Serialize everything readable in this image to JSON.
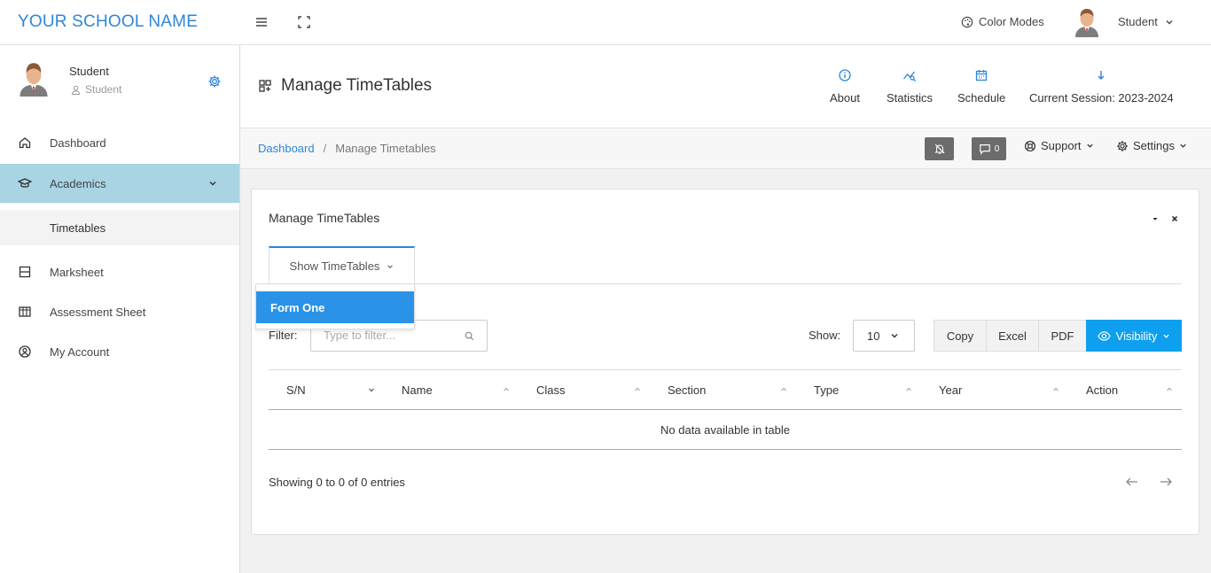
{
  "brand": "YOUR SCHOOL NAME",
  "topbar": {
    "color_modes_label": "Color Modes",
    "user_label": "Student"
  },
  "sidebar": {
    "user_name": "Student",
    "user_role": "Student",
    "items": [
      {
        "label": "Dashboard",
        "icon": "home-icon"
      },
      {
        "label": "Academics",
        "icon": "graduation-cap-icon"
      },
      {
        "label": "Timetables",
        "icon": ""
      },
      {
        "label": "Marksheet",
        "icon": "marksheet-icon"
      },
      {
        "label": "Assessment Sheet",
        "icon": "assessment-icon"
      },
      {
        "label": "My Account",
        "icon": "user-circle-icon"
      }
    ]
  },
  "page_header": {
    "title": "Manage TimeTables",
    "actions": [
      {
        "label": "About",
        "icon": "info-icon"
      },
      {
        "label": "Statistics",
        "icon": "chart-icon"
      },
      {
        "label": "Schedule",
        "icon": "calendar-icon"
      },
      {
        "label": "Current Session: 2023-2024",
        "icon": "arrow-down-icon"
      }
    ]
  },
  "breadcrumb": {
    "home": "Dashboard",
    "separator": "/",
    "current": "Manage Timetables",
    "messages_count": "0",
    "support_label": "Support",
    "settings_label": "Settings"
  },
  "card": {
    "title": "Manage TimeTables",
    "tab_label": "Show TimeTables",
    "dropdown_options": [
      "Form One"
    ],
    "filter_label": "Filter:",
    "filter_placeholder": "Type to filter...",
    "show_label": "Show:",
    "page_size": "10",
    "export_buttons": [
      "Copy",
      "Excel",
      "PDF"
    ],
    "visibility_label": "Visibility",
    "columns": [
      "S/N",
      "Name",
      "Class",
      "Section",
      "Type",
      "Year",
      "Action"
    ],
    "empty_message": "No data available in table",
    "info": "Showing 0 to 0 of 0 entries"
  },
  "colors": {
    "accent": "#2f86d6",
    "sidebar_active": "#a8d4e3",
    "dropdown_active": "#2a93e8",
    "visibility_button": "#0ea0ef"
  }
}
